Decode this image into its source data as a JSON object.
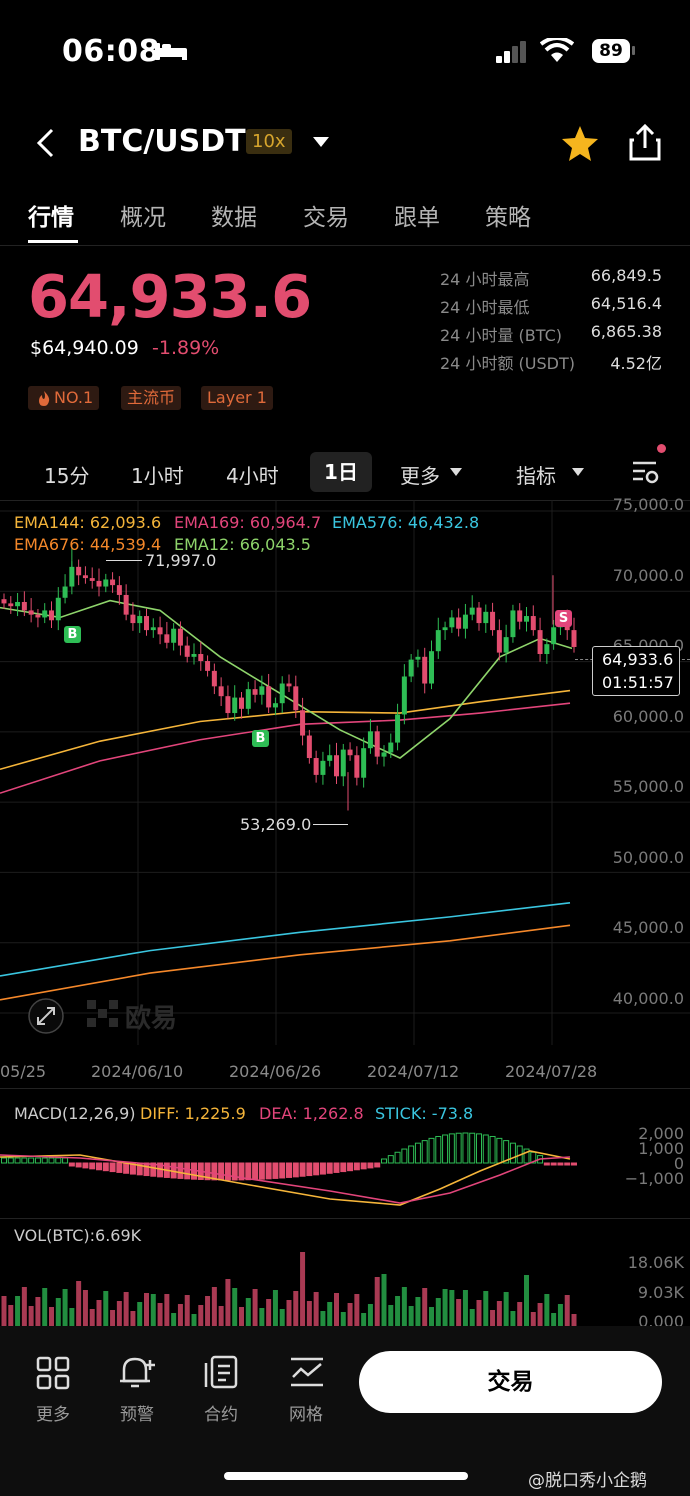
{
  "status_bar": {
    "time": "06:08",
    "battery": "89"
  },
  "header": {
    "pair": "BTC/USDT",
    "leverage": "10x"
  },
  "tabs": [
    "行情",
    "概况",
    "数据",
    "交易",
    "跟单",
    "策略"
  ],
  "ticker": {
    "price": "64,933.6",
    "usd_price": "$64,940.09",
    "change_pct": "-1.89%",
    "stats": [
      {
        "label": "24 小时最高",
        "value": "66,849.5"
      },
      {
        "label": "24 小时最低",
        "value": "64,516.4"
      },
      {
        "label": "24 小时量 (BTC)",
        "value": "6,865.38"
      },
      {
        "label": "24 小时额 (USDT)",
        "value": "4.52亿"
      }
    ],
    "badges": [
      "NO.1",
      "主流币",
      "Layer 1"
    ]
  },
  "timeframes": {
    "items": [
      "15分",
      "1小时",
      "4小时"
    ],
    "active": "1日",
    "more": "更多",
    "indicator": "指标"
  },
  "chart": {
    "ema_labels": {
      "ema144": "EMA144: 62,093.6",
      "ema169": "EMA169: 60,964.7",
      "ema576": "EMA576: 46,432.8",
      "ema676": "EMA676: 44,539.4",
      "ema12": "EMA12: 66,043.5"
    },
    "y_axis": [
      "75,000.0",
      "70,000.0",
      "65,000.0",
      "60,000.0",
      "55,000.0",
      "50,000.0",
      "45,000.0",
      "40,000.0"
    ],
    "high_marker": "71,997.0",
    "low_marker": "53,269.0",
    "current_price": "64,933.6",
    "countdown": "01:51:57",
    "dates": [
      "05/25",
      "2024/06/10",
      "2024/06/26",
      "2024/07/12",
      "2024/07/28"
    ],
    "watermark": "欧易",
    "signal_buy": "B",
    "signal_sell": "S",
    "colors": {
      "up": "#2ebd55",
      "down": "#e24d6f",
      "ema144": "#f5b53a",
      "ema169": "#e2457b",
      "ema576": "#3ac6e0",
      "ema676": "#f5882a",
      "ema12": "#8ed46b"
    }
  },
  "macd": {
    "title": "MACD(12,26,9)",
    "diff": "DIFF: 1,225.9",
    "dea": "DEA: 1,262.8",
    "stick": "STICK: -73.8",
    "axis": [
      "2,000",
      "1,000",
      "0",
      "−1,000"
    ]
  },
  "volume": {
    "title": "VOL(BTC):6.69K",
    "axis": [
      "18.06K",
      "9.03K",
      "0.000"
    ]
  },
  "bottom_nav": [
    {
      "label": "更多",
      "icon": "grid-icon"
    },
    {
      "label": "预警",
      "icon": "alert-bell-icon"
    },
    {
      "label": "合约",
      "icon": "contract-doc-icon"
    },
    {
      "label": "网格",
      "icon": "grid-strategy-icon"
    }
  ],
  "trade_button": "交易",
  "watermark_user": "@脱口秀小企鹅"
}
